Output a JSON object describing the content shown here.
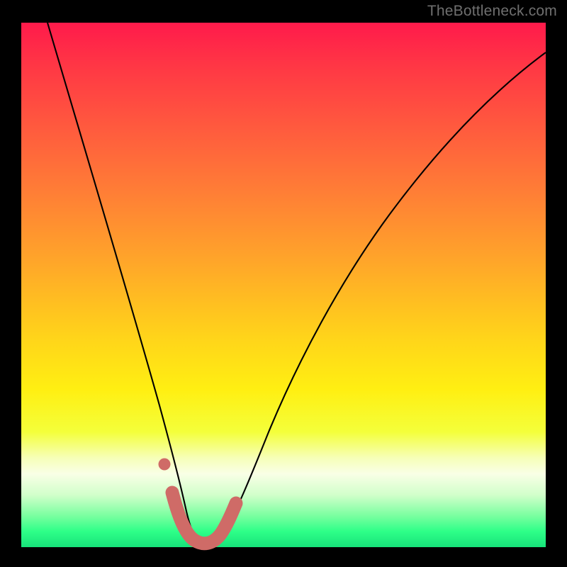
{
  "watermark": "TheBottleneck.com",
  "chart_data": {
    "type": "line",
    "title": "",
    "xlabel": "",
    "ylabel": "",
    "xlim": [
      0,
      100
    ],
    "ylim": [
      0,
      100
    ],
    "grid": false,
    "legend": false,
    "background_gradient": {
      "stops": [
        {
          "pos": 0,
          "color": "#ff1a4b"
        },
        {
          "pos": 20,
          "color": "#ff5a3e"
        },
        {
          "pos": 45,
          "color": "#ffa42a"
        },
        {
          "pos": 70,
          "color": "#ffef12"
        },
        {
          "pos": 86,
          "color": "#f9ffe6"
        },
        {
          "pos": 97,
          "color": "#2eff88"
        },
        {
          "pos": 100,
          "color": "#17e37a"
        }
      ]
    },
    "series": [
      {
        "name": "bottleneck-curve",
        "color": "#000000",
        "x": [
          5,
          10,
          15,
          20,
          23,
          26,
          28,
          30,
          31,
          32,
          33,
          34,
          36,
          38,
          40,
          43,
          47,
          52,
          58,
          65,
          73,
          82,
          92,
          100
        ],
        "y": [
          100,
          80,
          58,
          38,
          26,
          16,
          10,
          5,
          3,
          1.5,
          1,
          1,
          1,
          1.5,
          3,
          6,
          12,
          21,
          32,
          44,
          56,
          67,
          77,
          84
        ]
      },
      {
        "name": "highlight-band",
        "color": "#cf6b67",
        "x": [
          28.5,
          30,
          31,
          32,
          33,
          34,
          35.5,
          37,
          38.8
        ],
        "y": [
          10,
          4.5,
          2.5,
          1.8,
          1.5,
          1.5,
          1.8,
          2.6,
          5
        ]
      },
      {
        "name": "highlight-dot",
        "color": "#cf6b67",
        "x": [
          27.0
        ],
        "y": [
          15.5
        ]
      }
    ]
  }
}
